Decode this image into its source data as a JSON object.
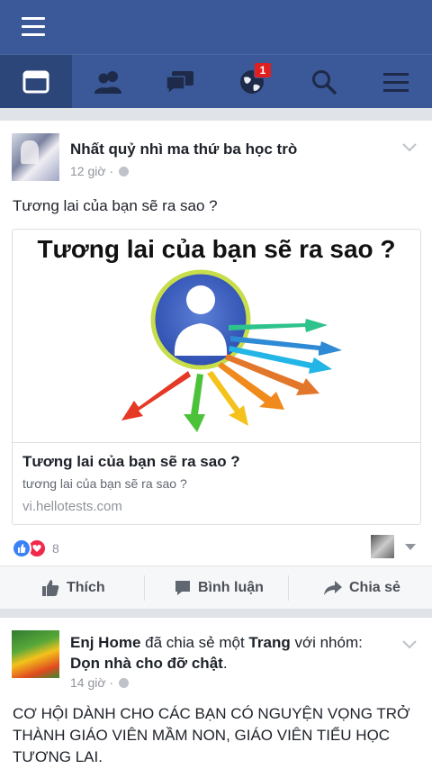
{
  "topbar": {
    "menu_icon": "hamburger-icon"
  },
  "nav": {
    "items": [
      {
        "name": "news-feed",
        "icon": "news-feed-icon",
        "active": true
      },
      {
        "name": "friends",
        "icon": "friends-icon"
      },
      {
        "name": "messages",
        "icon": "chat-icon"
      },
      {
        "name": "notifications",
        "icon": "globe-icon",
        "badge": "1"
      },
      {
        "name": "search",
        "icon": "search-icon"
      },
      {
        "name": "more",
        "icon": "menu-icon"
      }
    ]
  },
  "post1": {
    "author": "Nhất quỷ nhì ma thứ ba học trò",
    "time": "12 giờ ·",
    "text": "Tương lai của bạn sẽ ra sao ?",
    "link": {
      "image_title": "Tương lai của bạn sẽ ra sao ?",
      "title": "Tương lai của bạn sẽ ra sao ?",
      "description": "tương lai của bạn sẽ ra sao ?",
      "url": "vi.hellotests.com"
    },
    "reaction_count": "8",
    "actions": {
      "like": "Thích",
      "comment": "Bình luận",
      "share": "Chia sẻ"
    }
  },
  "post2": {
    "author": "Enj Home",
    "shared_text": " đã chia sẻ một ",
    "page_word": "Trang",
    "group_text": " với nhóm: ",
    "group": "Dọn nhà cho đỡ chật",
    "group_suffix": ".",
    "time": "14 giờ ·",
    "text": "CƠ HỘI DÀNH CHO CÁC BẠN CÓ NGUYỆN VỌNG TRỞ THÀNH GIÁO VIÊN MẦM NON, GIÁO VIÊN TIỂU HỌC TƯƠNG LAI."
  },
  "colors": {
    "brand": "#3b5998",
    "active_tab": "#2d4679",
    "badge": "#e02020"
  }
}
